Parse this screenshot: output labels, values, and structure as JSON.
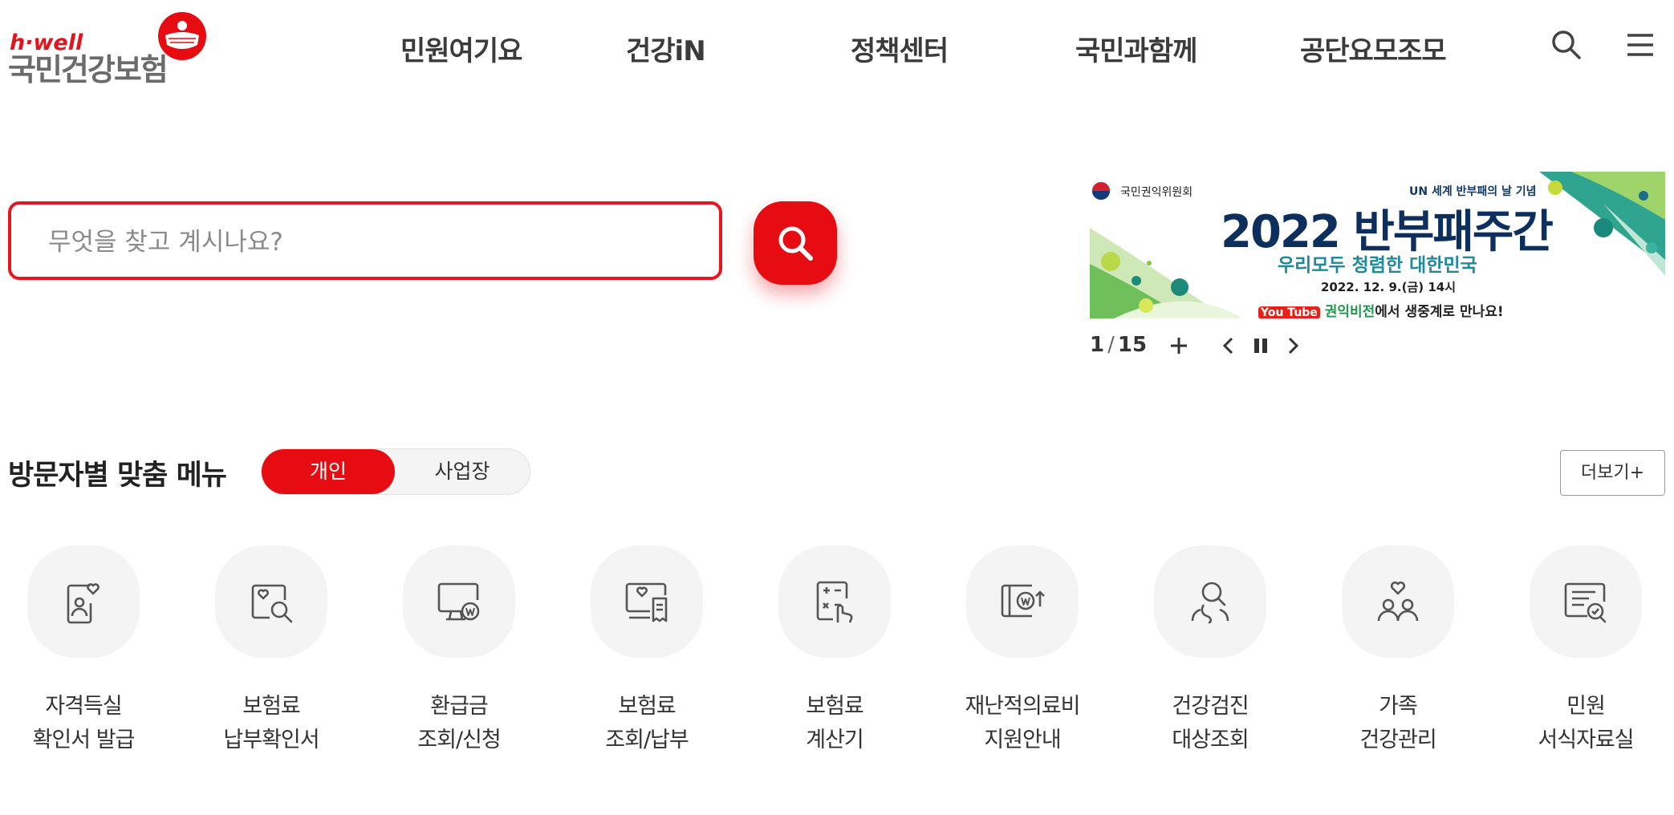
{
  "brand": {
    "tag": "h·well",
    "name": "국민건강보험"
  },
  "nav": {
    "items": [
      "민원여기요",
      "건강iN",
      "정책센터",
      "국민과함께",
      "공단요모조모"
    ]
  },
  "header": {
    "search_icon": "search-icon",
    "menu_icon": "hamburger-menu-icon"
  },
  "search": {
    "placeholder": "무엇을 찾고 계시나요?",
    "value": ""
  },
  "banner": {
    "org": "국민권익위원회",
    "un_note": "UN 세계 반부패의 날 기념",
    "title": "2022 반부패주간",
    "subtitle": "우리모두 청렴한 대한민국",
    "date": "2022. 12. 9.(금) 14시",
    "cta_youtube": "You Tube",
    "cta_channel": "권익비전",
    "cta_rest": "에서 생중계로 만나요!"
  },
  "pager": {
    "current": "1",
    "total": "15",
    "separator": "/"
  },
  "section": {
    "title": "방문자별 맞춤 메뉴",
    "toggle": [
      "개인",
      "사업장"
    ],
    "more": "더보기+"
  },
  "menu": [
    {
      "l1": "자격득실",
      "l2": "확인서 발급",
      "icon": "id-card-heart-icon"
    },
    {
      "l1": "보험료",
      "l2": "납부확인서",
      "icon": "document-search-icon"
    },
    {
      "l1": "환급금",
      "l2": "조회/신청",
      "icon": "monitor-won-icon"
    },
    {
      "l1": "보험료",
      "l2": "조회/납부",
      "icon": "monitor-receipt-icon"
    },
    {
      "l1": "보험료",
      "l2": "계산기",
      "icon": "calculator-hand-icon"
    },
    {
      "l1": "재난적의료비",
      "l2": "지원안내",
      "icon": "wallet-won-icon"
    },
    {
      "l1": "건강검진",
      "l2": "대상조회",
      "icon": "person-search-icon"
    },
    {
      "l1": "가족",
      "l2": "건강관리",
      "icon": "family-heart-icon"
    },
    {
      "l1": "민원",
      "l2": "서식자료실",
      "icon": "form-check-icon"
    }
  ],
  "colors": {
    "accent": "#e60c12",
    "navy": "#0c2f5e",
    "text": "#333333"
  }
}
